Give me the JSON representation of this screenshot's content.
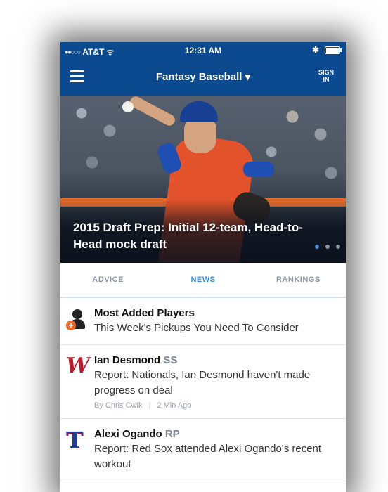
{
  "status_bar": {
    "signal_dots": "●●○○○",
    "carrier": "AT&T",
    "wifi_glyph": "ᯤ",
    "time": "12:31 AM",
    "bluetooth_glyph": "✱",
    "battery_level": 1.0
  },
  "navbar": {
    "title": "Fantasy Baseball ▾",
    "sign_in_line1": "SIGN",
    "sign_in_line2": "IN"
  },
  "hero": {
    "headline": "2015 Draft Prep: Initial 12-team, Head-to-Head mock draft",
    "carousel_count": 3,
    "carousel_active": 0
  },
  "tabs": [
    {
      "label": "ADVICE",
      "active": false
    },
    {
      "label": "NEWS",
      "active": true
    },
    {
      "label": "RANKINGS",
      "active": false
    }
  ],
  "feed": {
    "item0": {
      "title": "Most Added Players",
      "text": "This Week's Pickups You Need To Consider",
      "icon": "person-add-icon"
    },
    "item1": {
      "name": "Ian Desmond",
      "pos": "SS",
      "text": "Report: Nationals, Ian Desmond haven't made progress on deal",
      "author": "By Chris Cwik",
      "time": "2 Min Ago",
      "logo": "W",
      "icon": "nationals-logo-icon"
    },
    "item2": {
      "name": "Alexi Ogando",
      "pos": "RP",
      "text": "Report: Red Sox attended Alexi Ogando's recent workout",
      "logo": "T",
      "icon": "rangers-logo-icon"
    }
  },
  "colors": {
    "brand_blue": "#0b4a8f",
    "active_tab": "#3d8ddb",
    "accent_orange": "#ea6a2b"
  }
}
